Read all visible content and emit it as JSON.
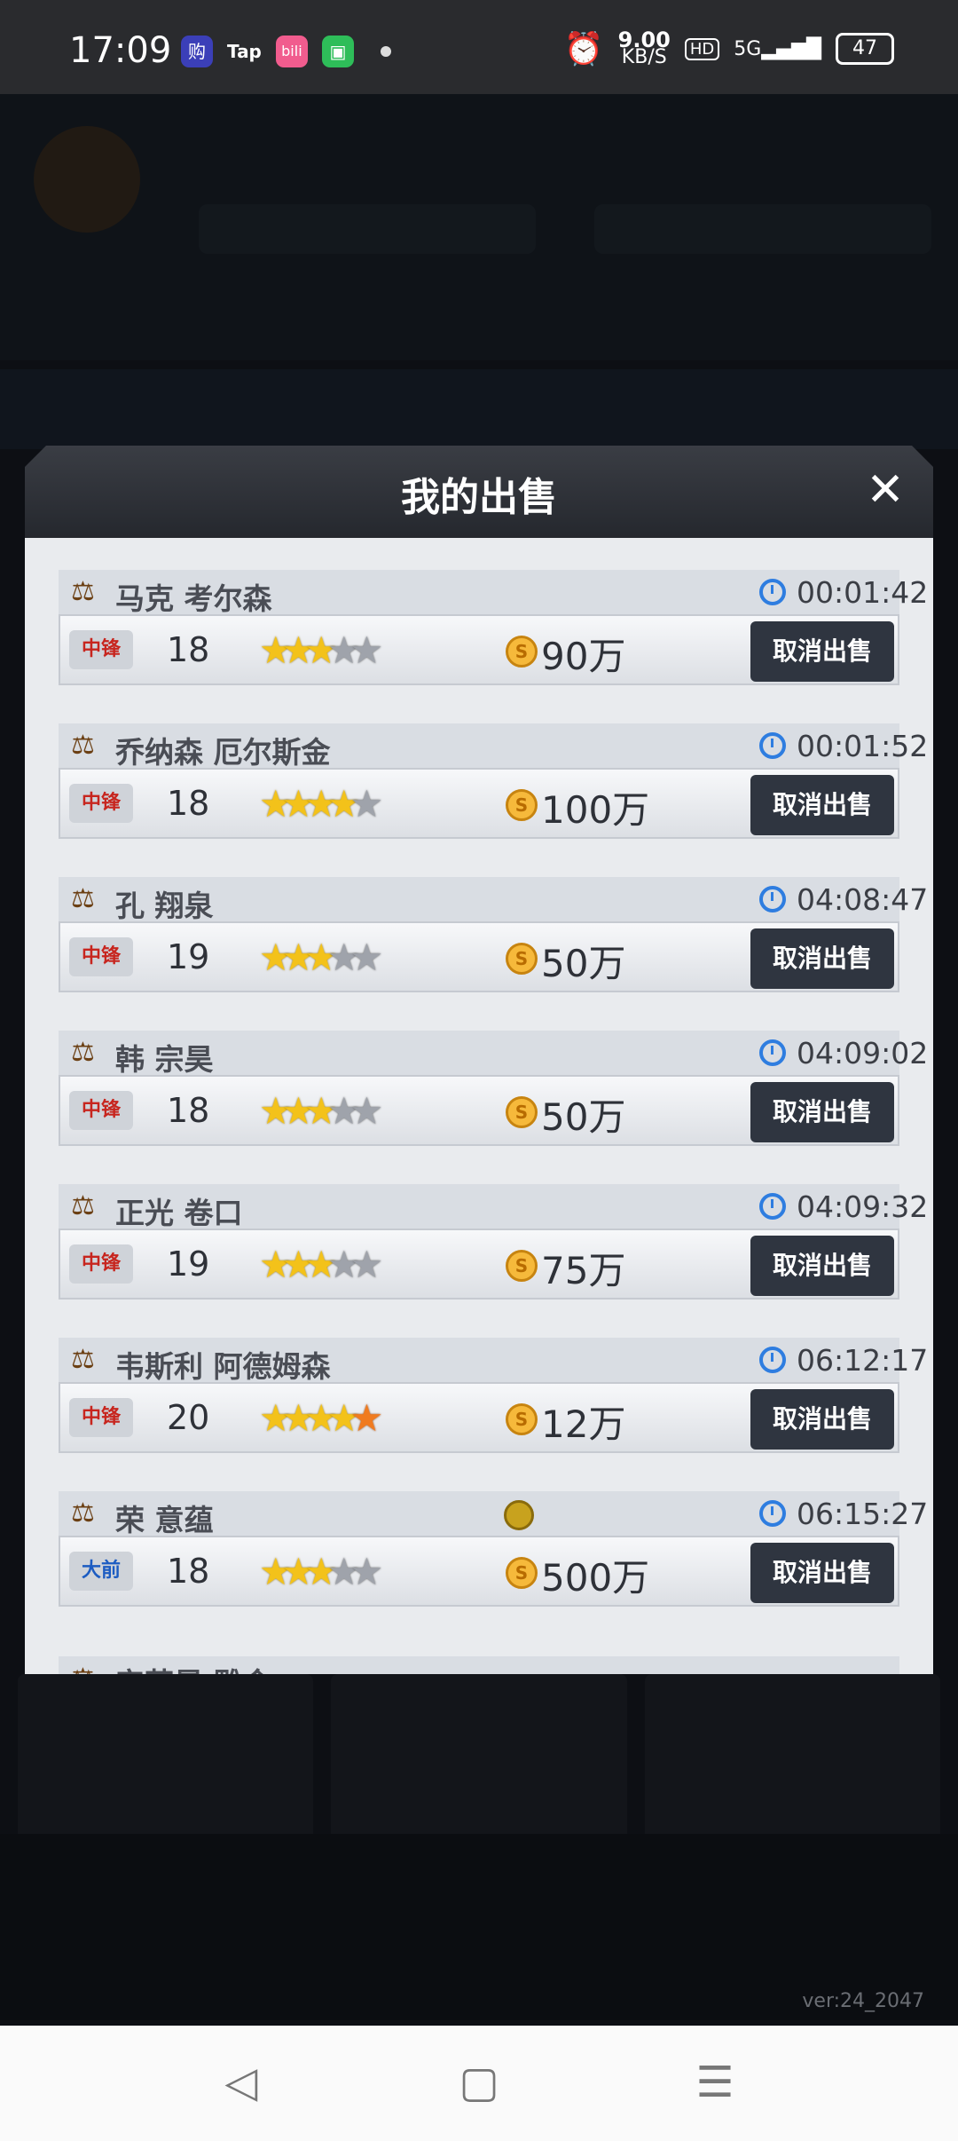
{
  "status_bar": {
    "time": "17:09",
    "apps": [
      {
        "label": "购",
        "color": "#3b3fb8"
      },
      {
        "label": "Tap",
        "color": "#2a2b2e"
      },
      {
        "label": "bili",
        "color": "#f15c8e"
      },
      {
        "label": "▣",
        "color": "#2ebd59"
      }
    ],
    "speed_value": "9.00",
    "speed_unit": "KB/S",
    "hd": "HD",
    "network": "5G",
    "battery": "47"
  },
  "modal": {
    "title": "我的出售",
    "close_icon": "close-icon",
    "cancel_label": "取消出售",
    "items": [
      {
        "name": "马克 考尔森",
        "time": "00:01:42",
        "position": "中锋",
        "level": "18",
        "stars_gold": 3,
        "price": "90万"
      },
      {
        "name": "乔纳森 厄尔斯金",
        "time": "00:01:52",
        "position": "中锋",
        "level": "18",
        "stars_gold": 4,
        "price": "100万"
      },
      {
        "name": "孔 翔泉",
        "time": "04:08:47",
        "position": "中锋",
        "level": "19",
        "stars_gold": 3,
        "price": "50万"
      },
      {
        "name": "韩 宗昊",
        "time": "04:09:02",
        "position": "中锋",
        "level": "18",
        "stars_gold": 3,
        "price": "50万"
      },
      {
        "name": "正光 卷口",
        "time": "04:09:32",
        "position": "中锋",
        "level": "19",
        "stars_gold": 3,
        "price": "75万"
      },
      {
        "name": "韦斯利 阿德姆森",
        "time": "06:12:17",
        "position": "中锋",
        "level": "20",
        "stars_gold": 4,
        "price": "12万"
      },
      {
        "name": "荣 意蕴",
        "time": "06:15:27",
        "position": "大前",
        "level": "18",
        "stars_gold": 3,
        "price": "500万"
      }
    ],
    "peek_name": "安苏晨 雕金"
  },
  "version": "ver:24_2047"
}
